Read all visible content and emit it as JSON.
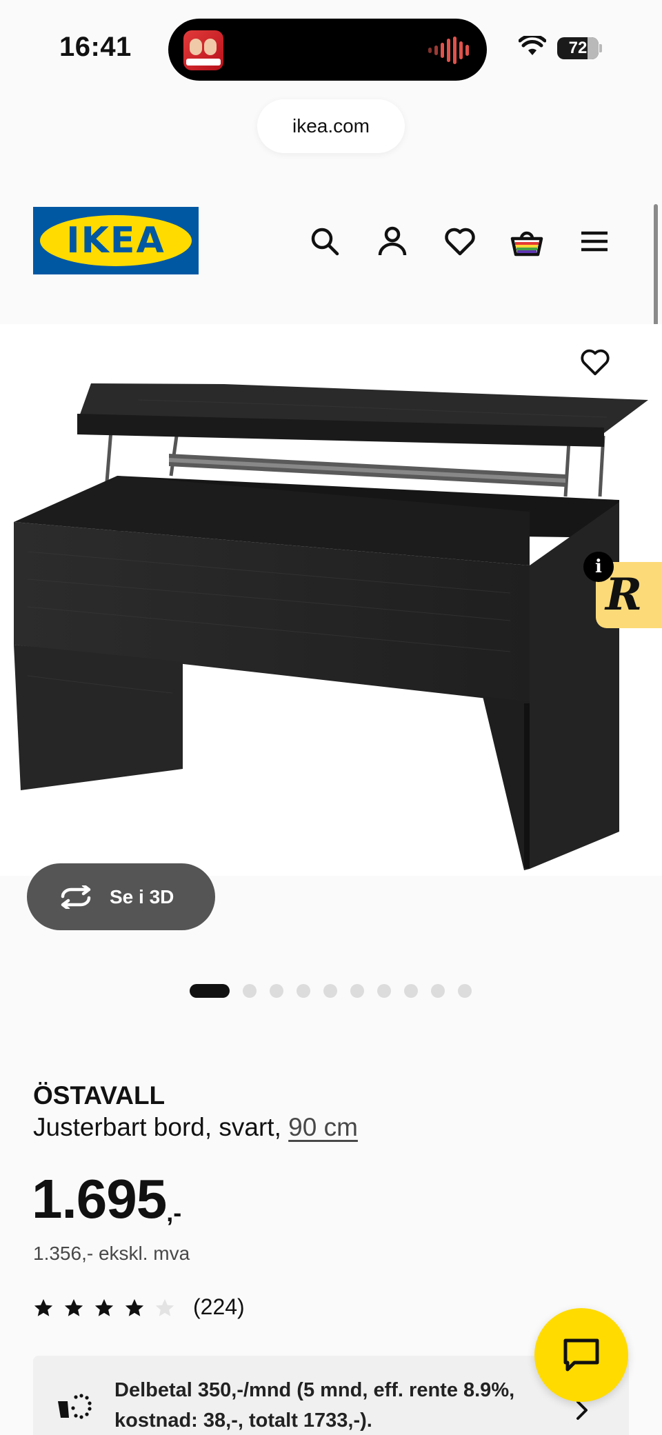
{
  "status_bar": {
    "time": "16:41",
    "battery": "72"
  },
  "browser": {
    "url": "ikea.com"
  },
  "header": {
    "logo": "IKEA"
  },
  "media": {
    "view_3d_label": "Se i 3D",
    "dot_count": 10,
    "active_dot": 0
  },
  "product": {
    "name": "ÖSTAVALL",
    "description": "Justerbart bord, svart, ",
    "size": "90 cm",
    "price": "1.695",
    "price_suffix": ",-",
    "price_ex_vat": "1.356,- ekskl. mva",
    "rating": 4,
    "rating_max": 5,
    "reviews": "(224)"
  },
  "finance": {
    "text": "Delbetal 350,-/mnd (5 mnd, eff. rente 8.9%, kostnad: 38,-, totalt 1733,-)."
  },
  "colors": {
    "ikea_blue": "#0058a3",
    "ikea_yellow": "#ffdb00",
    "badge_yellow": "#fdda78"
  }
}
